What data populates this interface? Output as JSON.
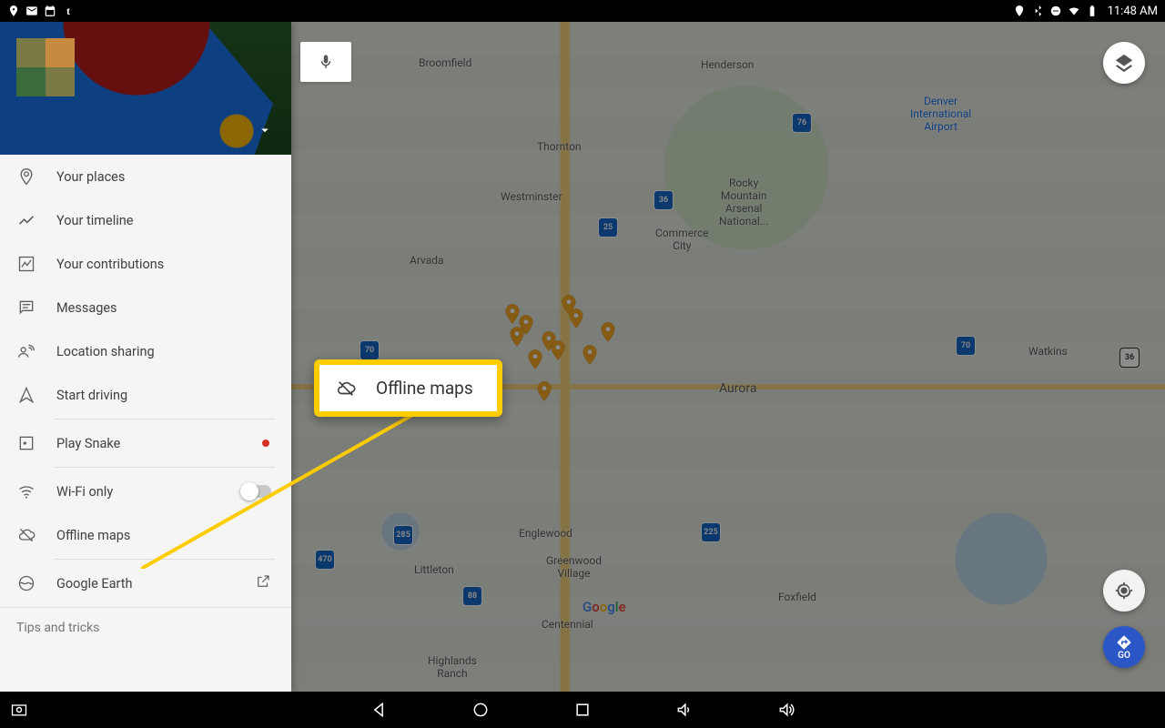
{
  "status": {
    "time": "11:48 AM"
  },
  "drawer": {
    "your_places": "Your places",
    "your_timeline": "Your timeline",
    "your_contributions": "Your contributions",
    "messages": "Messages",
    "location_sharing": "Location sharing",
    "start_driving": "Start driving",
    "play_snake": "Play Snake",
    "wifi_only": "Wi-Fi only",
    "offline_maps": "Offline maps",
    "google_earth": "Google Earth",
    "tips": "Tips and tricks"
  },
  "callout": {
    "label": "Offline maps"
  },
  "map": {
    "labels": {
      "broomfield": "Broomfield",
      "henderson": "Henderson",
      "thornton": "Thornton",
      "westminster": "Westminster",
      "arvada": "Arvada",
      "commerce_city": "Commerce\nCity",
      "rmanp": "Rocky\nMountain\nArsenal\nNational...",
      "aurora": "Aurora",
      "watkins": "Watkins",
      "englewood": "Englewood",
      "littleton": "Littleton",
      "greenwood": "Greenwood\nVillage",
      "centennial": "Centennial",
      "foxfield": "Foxfield",
      "highlands": "Highlands\nRanch",
      "dia": "Denver\nInternational\nAirport"
    },
    "hwy": {
      "i25a": "25",
      "i70a": "70",
      "i76": "76",
      "i225": "225",
      "us36": "36",
      "i70b": "70",
      "us285": "285",
      "i470": "470",
      "us88": "88"
    }
  },
  "fab": {
    "go": "GO"
  }
}
